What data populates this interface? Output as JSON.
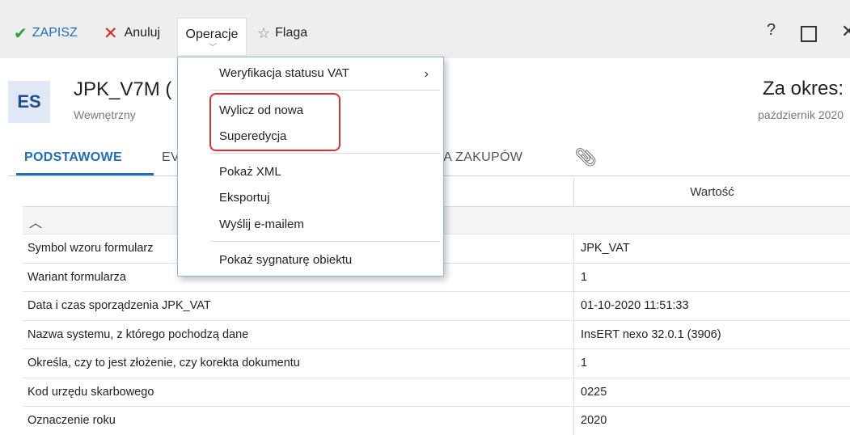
{
  "toolbar": {
    "save_label": "ZAPISZ",
    "cancel_label": "Anuluj",
    "operations_label": "Operacje",
    "flag_label": "Flaga",
    "help_label": "?"
  },
  "header": {
    "badge": "ES",
    "title": "JPK_V7M (",
    "subtitle": "Wewnętrzny",
    "period_label": "Za okres:",
    "period_value": "październik 2020"
  },
  "tabs": [
    {
      "label": "PODSTAWOWE",
      "active": true
    },
    {
      "label": "EV"
    },
    {
      "label": "JA ZAKUPÓW"
    }
  ],
  "grid": {
    "value_header": "Wartość",
    "rows": [
      {
        "key": "Symbol wzoru formularz",
        "value": "JPK_VAT"
      },
      {
        "key": "Wariant formularza",
        "value": "1"
      },
      {
        "key": "Data i czas sporządzenia JPK_VAT",
        "value": "01-10-2020 11:51:33"
      },
      {
        "key": "Nazwa systemu, z którego pochodzą dane",
        "value": "InsERT nexo 32.0.1 (3906)"
      },
      {
        "key": "Określa, czy to jest złożenie, czy korekta dokumentu",
        "value": "1"
      },
      {
        "key": "Kod urzędu skarbowego",
        "value": "0225"
      },
      {
        "key": "Oznaczenie roku",
        "value": "2020"
      }
    ]
  },
  "menu": {
    "items": [
      {
        "label": "Weryfikacja statusu VAT",
        "has_submenu": true
      },
      {
        "label": "Wylicz od nowa",
        "highlighted": true
      },
      {
        "label": "Superedycja",
        "highlighted": true
      },
      {
        "label": "Pokaż XML"
      },
      {
        "label": "Eksportuj"
      },
      {
        "label": "Wyślij e-mailem"
      },
      {
        "label": "Pokaż sygnaturę obiektu"
      }
    ]
  },
  "colors": {
    "accent": "#1f6fb8",
    "save_check": "#2aa338",
    "cancel_x": "#e02020",
    "highlight_box": "#e03030"
  }
}
